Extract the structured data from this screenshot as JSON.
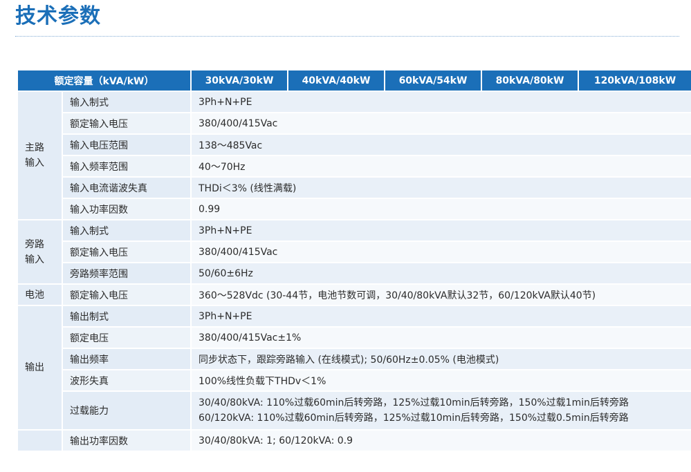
{
  "page": {
    "title": "技术参数"
  },
  "table": {
    "header": {
      "rated_label": "额定容量（kVA/kW）",
      "models": [
        "30kVA/30kW",
        "40kVA/40kW",
        "60kVA/54kW",
        "80kVA/80kW",
        "120kVA/108kW"
      ]
    },
    "groups": {
      "main_input": "主路\n输入",
      "bypass_input": "旁路\n输入",
      "battery": "电池",
      "output": "输出"
    },
    "rows": [
      {
        "param": "输入制式",
        "value": "3Ph+N+PE"
      },
      {
        "param": "额定输入电压",
        "value": "380/400/415Vac"
      },
      {
        "param": "输入电压范围",
        "value": "138～485Vac"
      },
      {
        "param": "输入频率范围",
        "value": "40～70Hz"
      },
      {
        "param": "输入电流谐波失真",
        "value": "THDi＜3% (线性满载)"
      },
      {
        "param": "输入功率因数",
        "value": "0.99"
      },
      {
        "param": "输入制式",
        "value": "3Ph+N+PE"
      },
      {
        "param": "额定输入电压",
        "value": "380/400/415Vac"
      },
      {
        "param": "旁路频率范围",
        "value": "50/60±6Hz"
      },
      {
        "param": "额定输入电压",
        "value": "360～528Vdc (30-44节，电池节数可调，30/40/80kVA默认32节，60/120kVA默认40节)"
      },
      {
        "param": "输出制式",
        "value": "3Ph+N+PE"
      },
      {
        "param": "额定电压",
        "value": "380/400/415Vac±1%"
      },
      {
        "param": "输出频率",
        "value": "同步状态下，跟踪旁路输入 (在线模式); 50/60Hz±0.05% (电池模式)"
      },
      {
        "param": "波形失真",
        "value": "100%线性负载下THDv＜1%"
      },
      {
        "param": "过载能力",
        "value": "30/40/80kVA: 110%过载60min后转旁路，125%过载10min后转旁路，150%过载1min后转旁路",
        "value2": "60/120kVA: 110%过载60min后转旁路，125%过载10min后转旁路，150%过载0.5min后转旁路"
      },
      {
        "param": "输出功率因数",
        "value": "30/40/80kVA: 1;     60/120kVA: 0.9"
      }
    ]
  }
}
